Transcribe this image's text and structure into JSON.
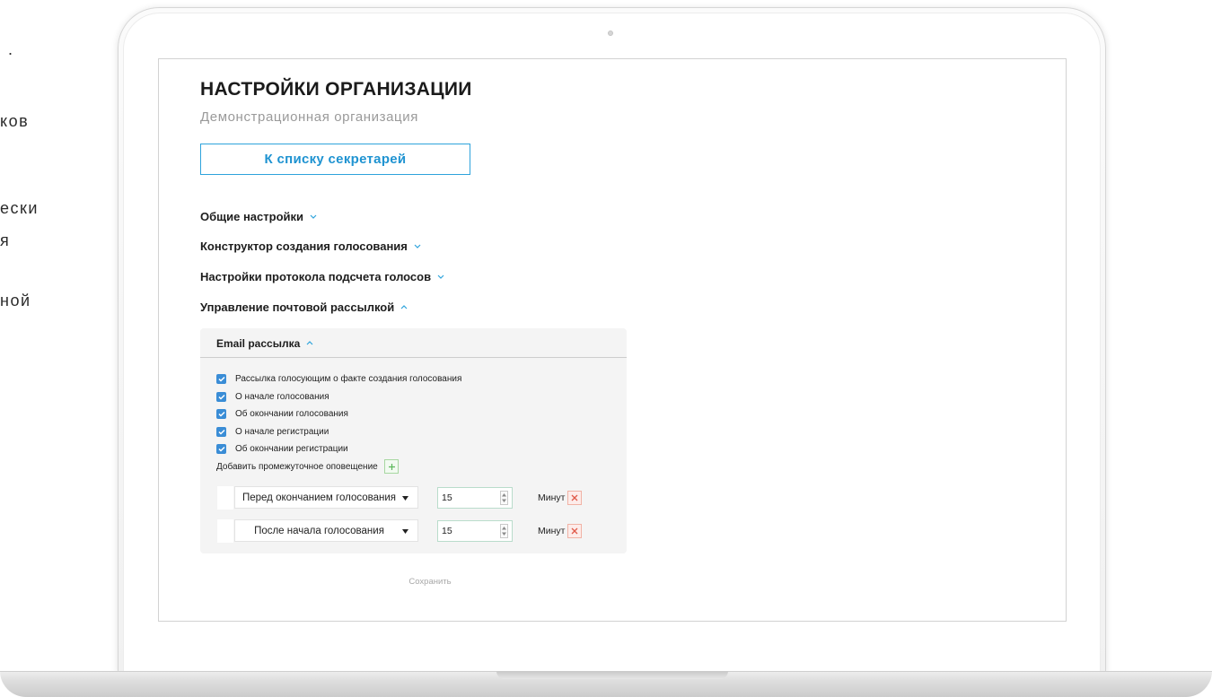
{
  "left_column": {
    "fragments": [
      ".",
      "ков",
      "ески",
      "я",
      "ной"
    ]
  },
  "page": {
    "title": "НАСТРОЙКИ ОРГАНИЗАЦИИ",
    "subtitle": "Демонстрационная организация",
    "secretaries_button": "К списку секретарей",
    "sections": [
      {
        "label": "Общие настройки",
        "expanded": false
      },
      {
        "label": "Конструктор создания голосования",
        "expanded": false
      },
      {
        "label": "Настройки протокола подсчета голосов",
        "expanded": false
      },
      {
        "label": "Управление почтовой рассылкой",
        "expanded": true
      }
    ],
    "email_panel": {
      "title": "Email рассылка",
      "expanded": true,
      "options": [
        {
          "label": "Рассылка голосующим о факте создания голосования",
          "checked": true
        },
        {
          "label": "О начале голосования",
          "checked": true
        },
        {
          "label": "Об окончании голосования",
          "checked": true
        },
        {
          "label": "О начале регистрации",
          "checked": true
        },
        {
          "label": "Об окончании регистрации",
          "checked": true
        }
      ],
      "add_label": "Добавить промежуточное оповещение",
      "notifications": [
        {
          "event": "Перед окончанием голосования",
          "value": "15",
          "unit": "Минут"
        },
        {
          "event": "После начала голосования",
          "value": "15",
          "unit": "Минут"
        }
      ]
    },
    "save_button": "Сохранить"
  },
  "icons": {
    "section_toggle": "chevron-icon",
    "option_check": "checkmark-icon",
    "add": "plus-icon",
    "remove": "close-icon",
    "dropdown": "caret-down-icon",
    "number_stepper": "spinner-arrows-icon",
    "camera": "camera-dot"
  },
  "colors": {
    "accent": "#2ea3dc",
    "checkbox": "#3a8dd6",
    "add": "#5cb85c",
    "remove": "#e05a4a",
    "panel_background": "#f4f4f4"
  }
}
